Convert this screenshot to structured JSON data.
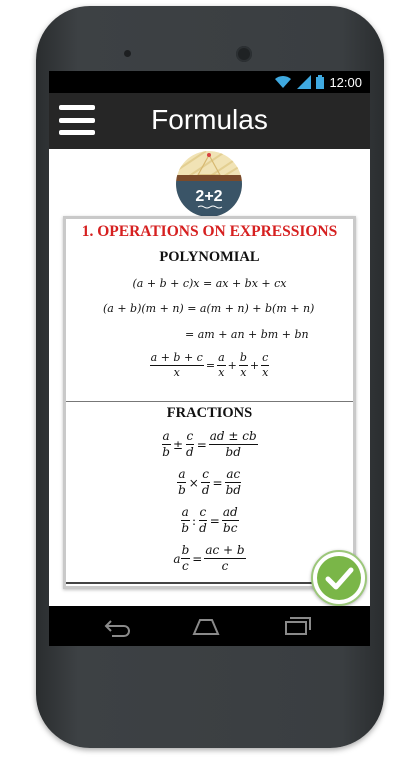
{
  "statusbar": {
    "time": "12:00",
    "icons": [
      "wifi-icon",
      "signal-icon",
      "battery-icon"
    ]
  },
  "appbar": {
    "title": "Formulas",
    "menu_icon": "hamburger-menu-icon"
  },
  "logo": {
    "text": "2+2"
  },
  "section": {
    "title": "1. OPERATIONS ON EXPRESSIONS",
    "title_color": "#d62020",
    "polynomial": {
      "heading": "POLYNOMIAL",
      "eq1": "(a + b + c)x = ax + bx + cx",
      "eq2": "(a + b)(m + n) = a(m + n) + b(m + n)",
      "eq3": "= am + an + bm + bn",
      "eq4": {
        "lhs_num": "a + b + c",
        "lhs_den": "x",
        "t1_num": "a",
        "t1_den": "x",
        "t2_num": "b",
        "t2_den": "x",
        "t3_num": "c",
        "t3_den": "x"
      }
    },
    "fractions": {
      "heading": "FRACTIONS",
      "f1": {
        "a_num": "a",
        "a_den": "b",
        "op": "±",
        "b_num": "c",
        "b_den": "d",
        "r_num": "ad ± cb",
        "r_den": "bd"
      },
      "f2": {
        "a_num": "a",
        "a_den": "b",
        "op": "×",
        "b_num": "c",
        "b_den": "d",
        "r_num": "ac",
        "r_den": "bd"
      },
      "f3": {
        "a_num": "a",
        "a_den": "b",
        "op": ":",
        "b_num": "c",
        "b_den": "d",
        "r_num": "ad",
        "r_den": "bc"
      },
      "f4": {
        "prefix": "a",
        "a_num": "b",
        "a_den": "c",
        "r_num": "ac + b",
        "r_den": "c"
      }
    }
  },
  "fab": {
    "icon": "checkmark-icon",
    "color": "#7ab648"
  },
  "navbar": {
    "icons": [
      "back-icon",
      "home-icon",
      "recent-apps-icon"
    ]
  }
}
